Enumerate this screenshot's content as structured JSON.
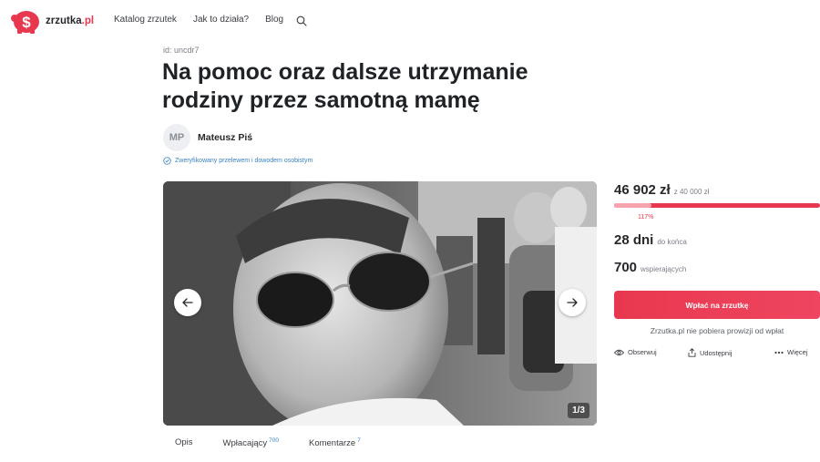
{
  "header": {
    "logo_text": "zrzutka",
    "logo_suffix": ".pl",
    "nav": [
      {
        "label": "Katalog zrzutek"
      },
      {
        "label": "Jak to działa?"
      },
      {
        "label": "Blog"
      }
    ],
    "search_icon": "search-icon"
  },
  "campaign": {
    "id_label": "id: uncdr7",
    "title": "Na pomoc oraz dalsze utrzymanie rodziny przez samotną mamę",
    "author_initials": "MP",
    "author_name": "Mateusz Piś",
    "verified_text": "Zweryfikowany przelewem i dowodem osobistym"
  },
  "gallery": {
    "counter": "1/3",
    "prev_icon": "arrow-left-icon",
    "next_icon": "arrow-right-icon"
  },
  "tabs": [
    {
      "label": "Opis",
      "count": ""
    },
    {
      "label": "Wpłacający",
      "count": "700"
    },
    {
      "label": "Komentarze",
      "count": "7"
    }
  ],
  "stats": {
    "amount": "46 902 zł",
    "goal": "z 40 000 zł",
    "progress_fraction": 1.0,
    "percent": "117%",
    "days_num": "28 dni",
    "days_label": "do końca",
    "supporters_num": "700",
    "supporters_label": "wspierających"
  },
  "cta": {
    "donate_label": "Wpłać na zrzutkę",
    "no_fee_text": "Zrzutka.pl nie pobiera prowizji od wpłat"
  },
  "actions": [
    {
      "label": "Obserwuj",
      "icon": "eye-icon"
    },
    {
      "label": "Udostępnij",
      "icon": "share-icon"
    },
    {
      "label": "Więcej",
      "icon": "more-dots-icon"
    }
  ],
  "colors": {
    "brand": "#e8384f",
    "link": "#3b82c4"
  }
}
